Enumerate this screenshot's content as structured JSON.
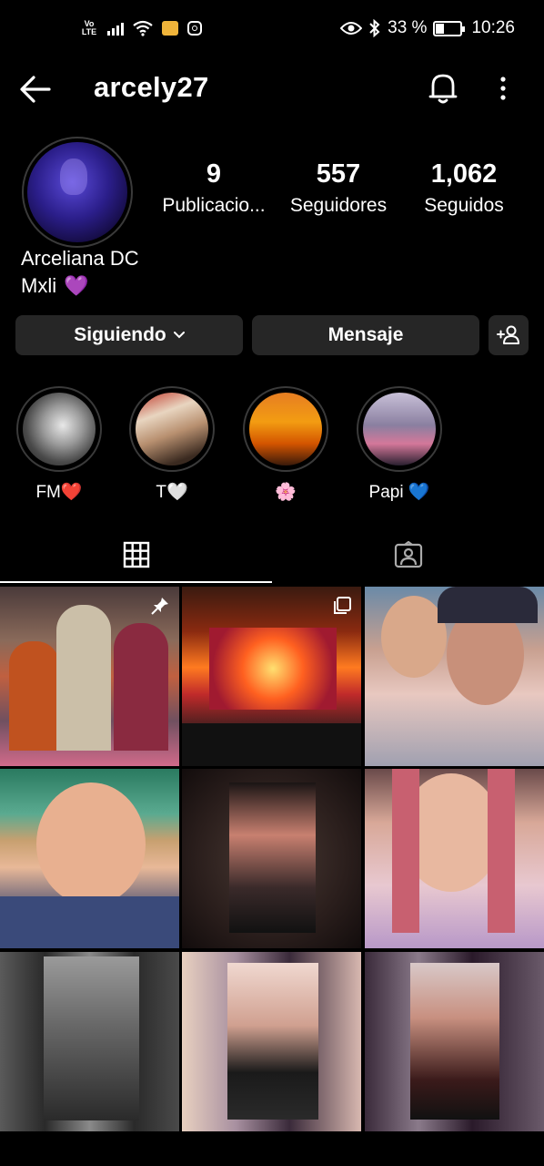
{
  "status_bar": {
    "network_label": "Vo LTE",
    "battery_percent": "33 %",
    "battery_level": 0.33,
    "time": "10:26"
  },
  "header": {
    "username": "arcely27"
  },
  "profile": {
    "stats": [
      {
        "value": "9",
        "label": "Publicacio..."
      },
      {
        "value": "557",
        "label": "Seguidores"
      },
      {
        "value": "1,062",
        "label": "Seguidos"
      }
    ],
    "display_name": "Arceliana DC",
    "bio_text": "Mxli",
    "bio_emoji": "💜"
  },
  "actions": {
    "following_label": "Siguiendo",
    "message_label": "Mensaje"
  },
  "highlights": [
    {
      "label": "FM❤️"
    },
    {
      "label": "T🤍"
    },
    {
      "label": "🌸"
    },
    {
      "label": "Papi 💙"
    }
  ],
  "tabs": {
    "active": "grid",
    "items": [
      "grid-icon",
      "tagged-icon"
    ]
  },
  "colors": {
    "background": "#000000",
    "button_bg": "#262626",
    "divider": "#3a3a3a",
    "text": "#ffffff"
  }
}
